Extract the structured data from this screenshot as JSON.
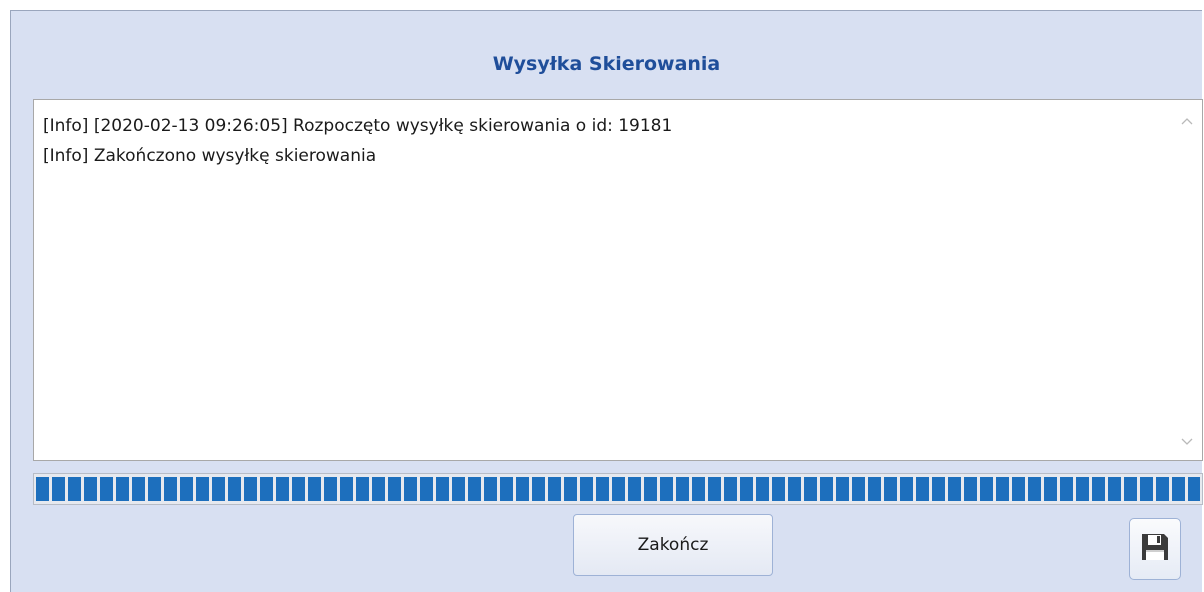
{
  "dialog": {
    "title": "Wysyłka Skierowania",
    "log": {
      "lines": [
        "[Info] [2020-02-13 09:26:05] Rozpoczęto wysyłkę skierowania o id: 19181",
        "[Info] Zakończono wysyłkę skierowania"
      ]
    },
    "progress": {
      "value_percent": 100,
      "color": "#1d6fbd"
    },
    "buttons": {
      "finish_label": "Zakończ",
      "save_icon": "floppy-disk-icon"
    }
  },
  "colors": {
    "background": "#d8e0f2",
    "title": "#1f4e9a",
    "accent": "#1d6fbd"
  }
}
